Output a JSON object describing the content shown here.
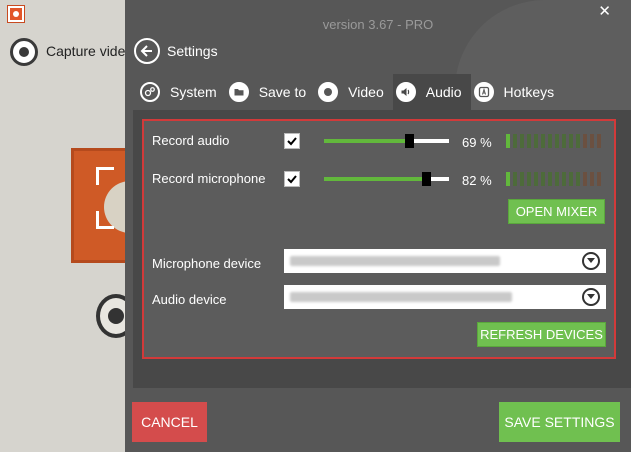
{
  "background_app": {
    "capture_label": "Capture video"
  },
  "header": {
    "version": "version 3.67 - PRO",
    "close_icon": "✕",
    "title": "Settings"
  },
  "tabs": [
    {
      "label": "System",
      "icon": "gears-icon"
    },
    {
      "label": "Save to",
      "icon": "folder-icon"
    },
    {
      "label": "Video",
      "icon": "record-icon"
    },
    {
      "label": "Audio",
      "icon": "speaker-icon",
      "active": true
    },
    {
      "label": "Hotkeys",
      "icon": "keyboard-key-icon"
    }
  ],
  "audio": {
    "record_audio": {
      "label": "Record audio",
      "checked": true,
      "level": 0.69,
      "percent": "69 %"
    },
    "record_microphone": {
      "label": "Record microphone",
      "checked": true,
      "level": 0.82,
      "percent": "82 %"
    },
    "open_mixer": "OPEN MIXER",
    "microphone_device": {
      "label": "Microphone device",
      "value_blurred": true
    },
    "audio_device": {
      "label": "Audio device",
      "value_blurred": true
    },
    "refresh_devices": "REFRESH DEVICES"
  },
  "footer": {
    "cancel": "CANCEL",
    "save": "SAVE SETTINGS"
  },
  "colors": {
    "accent_green": "#70c050",
    "cancel_red": "#d44c4c",
    "panel_border_red": "#d23a3a",
    "meter_on": "#62b83c",
    "meter_off": "#4d6b3a",
    "meter_peak_off": "#6b5040"
  }
}
